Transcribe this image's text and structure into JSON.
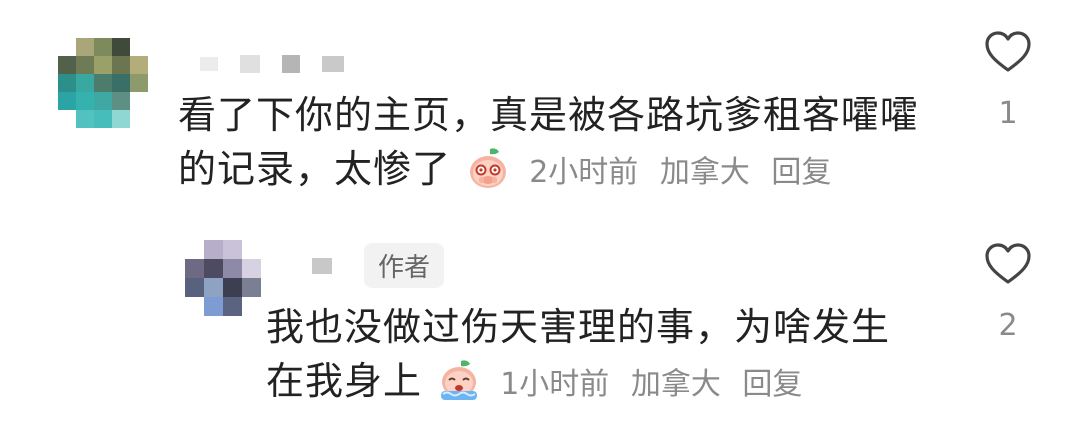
{
  "comments": [
    {
      "text_line1": "看了下你的主页，真是被各路坑爹租客嚯嚯",
      "text_line2": "的记录，太惨了",
      "time": "2小时前",
      "location": "加拿大",
      "reply_label": "回复",
      "like_count": "1",
      "emoji": "peach-crying-emoji"
    },
    {
      "author_badge": "作者",
      "text_line1": "我也没做过伤天害理的事，为啥发生",
      "text_line2": "在我身上",
      "time": "1小时前",
      "location": "加拿大",
      "reply_label": "回复",
      "like_count": "2",
      "emoji": "peach-sob-emoji"
    }
  ]
}
